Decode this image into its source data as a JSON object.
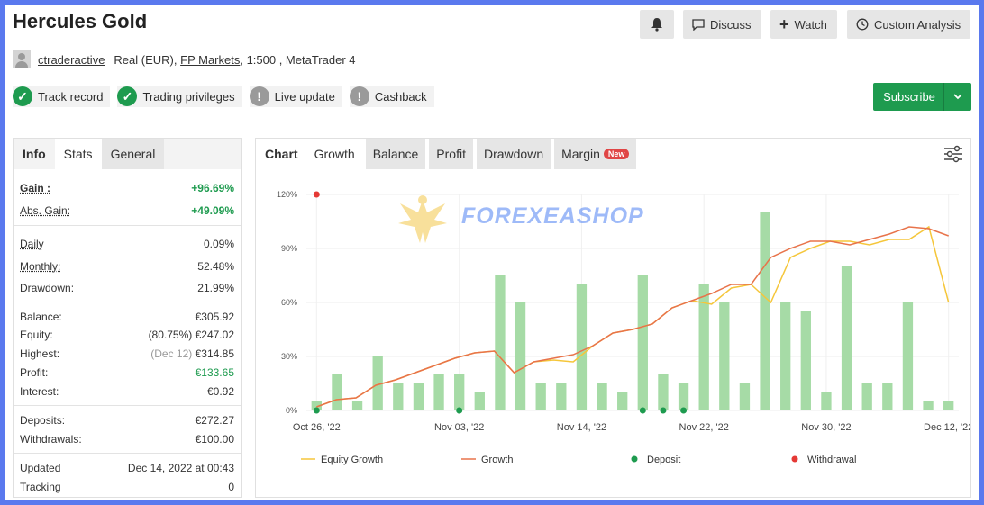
{
  "header": {
    "title": "Hercules Gold",
    "discuss_label": "Discuss",
    "watch_label": "Watch",
    "custom_analysis_label": "Custom Analysis"
  },
  "account": {
    "username": "ctraderactive",
    "type": "Real (EUR),",
    "broker": "FP Markets",
    "details": ", 1:500 , MetaTrader 4"
  },
  "badges": [
    {
      "label": "Track record",
      "status": "ok"
    },
    {
      "label": "Trading privileges",
      "status": "ok"
    },
    {
      "label": "Live update",
      "status": "warning"
    },
    {
      "label": "Cashback",
      "status": "warning"
    }
  ],
  "subscribe_label": "Subscribe",
  "left_tabs": [
    "Info",
    "Stats",
    "General"
  ],
  "stats": {
    "gain": {
      "label": "Gain :",
      "value": "+96.69%"
    },
    "abs_gain": {
      "label": "Abs. Gain:",
      "value": "+49.09%"
    },
    "daily": {
      "label": "Daily",
      "value": "0.09%"
    },
    "monthly": {
      "label": "Monthly:",
      "value": "52.48%"
    },
    "drawdown": {
      "label": "Drawdown:",
      "value": "21.99%"
    },
    "balance": {
      "label": "Balance:",
      "value": "€305.92"
    },
    "equity": {
      "label": "Equity:",
      "sub": "(80.75%)",
      "value": "€247.02"
    },
    "highest": {
      "label": "Highest:",
      "sub": "(Dec 12)",
      "value": "€314.85"
    },
    "profit": {
      "label": "Profit:",
      "value": "€133.65"
    },
    "interest": {
      "label": "Interest:",
      "value": "€0.92"
    },
    "deposits": {
      "label": "Deposits:",
      "value": "€272.27"
    },
    "withdrawals": {
      "label": "Withdrawals:",
      "value": "€100.00"
    },
    "updated": {
      "label": "Updated",
      "value": "Dec 14, 2022 at 00:43"
    },
    "tracking": {
      "label": "Tracking",
      "value": "0"
    }
  },
  "right_tabs": {
    "chart": "Chart",
    "growth": "Growth",
    "balance": "Balance",
    "profit": "Profit",
    "drawdown": "Drawdown",
    "margin": "Margin",
    "new_badge": "New"
  },
  "watermark": "FOREXEASHOP",
  "colors": {
    "green": "#1e9b4f",
    "growth_line": "#e8734a",
    "equity_line": "#f5c63a",
    "bar": "#a6dba6",
    "deposit": "#1e9b4f",
    "withdrawal": "#e53935"
  },
  "chart_data": {
    "type": "bar",
    "ylim": [
      0,
      120
    ],
    "yticks": [
      0,
      30,
      60,
      90,
      120
    ],
    "ytick_labels": [
      "0%",
      "30%",
      "60%",
      "90%",
      "120%"
    ],
    "x_tick_labels": [
      {
        "i": 0,
        "label": "Oct 26, '22"
      },
      {
        "i": 7,
        "label": "Nov 03, '22"
      },
      {
        "i": 13,
        "label": "Nov 14, '22"
      },
      {
        "i": 19,
        "label": "Nov 22, '22"
      },
      {
        "i": 25,
        "label": "Nov 30, '22"
      },
      {
        "i": 31,
        "label": "Dec 12, '22"
      }
    ],
    "n_points": 32,
    "series": [
      {
        "name": "Profit bars",
        "type": "bar",
        "values": [
          5,
          20,
          5,
          30,
          15,
          15,
          20,
          20,
          10,
          75,
          60,
          15,
          15,
          70,
          15,
          10,
          75,
          20,
          15,
          70,
          60,
          15,
          110,
          60,
          55,
          10,
          80,
          15,
          15,
          60,
          5,
          5
        ]
      },
      {
        "name": "Growth",
        "type": "line",
        "values": [
          2,
          6,
          7,
          14,
          17,
          21,
          25,
          29,
          32,
          33,
          21,
          27,
          29,
          31,
          36,
          43,
          45,
          48,
          57,
          61,
          65,
          70,
          70,
          85,
          90,
          94,
          94,
          92,
          95,
          98,
          102,
          101,
          97
        ]
      },
      {
        "name": "Equity Growth",
        "type": "line",
        "values": [
          2,
          6,
          7,
          14,
          17,
          21,
          25,
          29,
          32,
          33,
          21,
          27,
          28,
          27,
          36,
          43,
          45,
          48,
          57,
          61,
          59,
          68,
          70,
          60,
          85,
          90,
          94,
          94,
          92,
          95,
          95,
          102,
          60
        ]
      }
    ],
    "deposits_x": [
      0,
      7,
      16,
      17,
      18
    ],
    "withdrawals_x": [
      0
    ],
    "withdrawal_y": 120,
    "legend": [
      "Equity Growth",
      "Growth",
      "Deposit",
      "Withdrawal"
    ],
    "legend_position": "bottom"
  }
}
